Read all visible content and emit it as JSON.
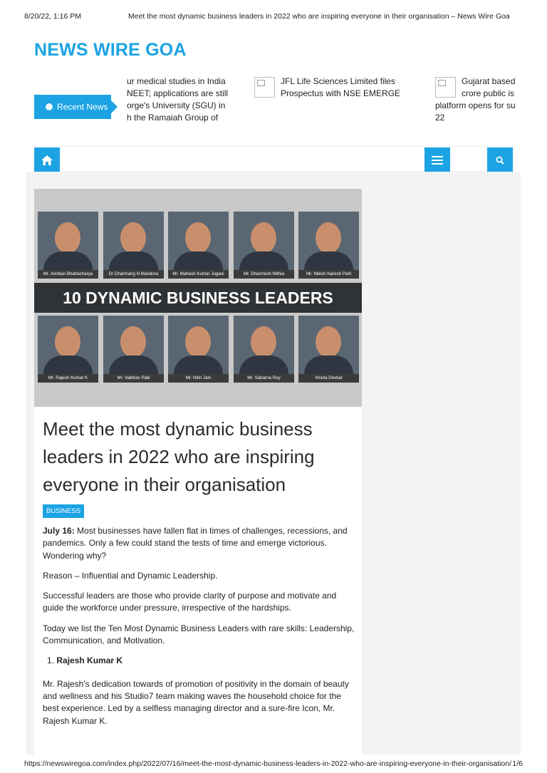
{
  "print_header": {
    "datetime": "8/20/22, 1:16 PM",
    "page_title": "Meet the most dynamic business leaders in 2022 who are inspiring everyone in their organisation – News Wire Goa"
  },
  "site": {
    "title": "NEWS WIRE GOA"
  },
  "recent_news": {
    "label": "Recent News",
    "items": [
      {
        "lines": [
          "ur medical studies in India",
          "NEET; applications are still",
          "orge's University (SGU) in",
          "h the Ramaiah Group of"
        ]
      },
      {
        "lines": [
          "JFL Life Sciences Limited files",
          "Prospectus with NSE EMERGE"
        ]
      },
      {
        "lines": [
          "Gujarat based",
          "crore public is",
          "platform opens for su",
          "22"
        ]
      }
    ]
  },
  "nav": {
    "home_icon": "home-icon",
    "menu_icon": "hamburger-menu-icon",
    "search_icon": "search-icon"
  },
  "hero": {
    "banner": "10 DYNAMIC BUSINESS LEADERS",
    "top_row": [
      "Mr. Anirban Bhattacharya",
      "Dr Dharmang N Mandora",
      "Mr. Mahesh Kumar Jogani",
      "Mr. Dharmesh Mithia",
      "Mr. Nilesh Naresh Patil"
    ],
    "bottom_row": [
      "Mr. Rajesh Kumar K",
      "Mr. Vaibhav Patil",
      "Mr. Nitin Jain",
      "Mr. Sabarna Roy",
      "Vineta Devkar"
    ]
  },
  "article": {
    "headline": "Meet the most dynamic business leaders in 2022 who are inspiring everyone in their organisation",
    "category": "BUSINESS",
    "lead_date": "July 16:",
    "lead_text": " Most businesses have fallen flat in times of challenges, recessions, and pandemics. Only a few could stand the tests of time and emerge victorious. Wondering why?",
    "p2": "Reason – Influential and Dynamic Leadership.",
    "p3": "Successful leaders are those who provide clarity of purpose and motivate and guide the workforce under pressure, irrespective of the hardships.",
    "p4": "Today we list the Ten Most Dynamic Business Leaders with rare skills: Leadership, Communication, and Motivation.",
    "list_number": "1.",
    "list_item": "Rajesh Kumar K",
    "p5": "Mr. Rajesh's dedication towards of promotion of positivity in the domain of beauty and wellness and his Studio7 team making waves the household choice for the best experience. Led by a selfless managing director and a sure-fire Icon, Mr. Rajesh Kumar K."
  },
  "print_footer": {
    "url": "https://newswiregoa.com/index.php/2022/07/16/meet-the-most-dynamic-business-leaders-in-2022-who-are-inspiring-everyone-in-their-organisation/",
    "page": "1/6"
  },
  "colors": {
    "accent": "#1ba3e3",
    "banner": "#303336"
  }
}
